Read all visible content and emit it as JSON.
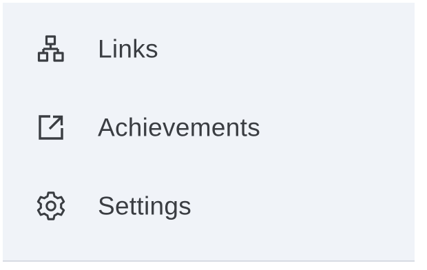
{
  "nav": {
    "items": [
      {
        "label": "Links",
        "icon": "sitemap-icon"
      },
      {
        "label": "Achievements",
        "icon": "external-link-icon"
      },
      {
        "label": "Settings",
        "icon": "gear-icon"
      }
    ]
  },
  "colors": {
    "panel_background": "#f0f3f8",
    "text": "#3a3d42",
    "icon": "#3a3d42",
    "divider": "#d6dbe2"
  }
}
